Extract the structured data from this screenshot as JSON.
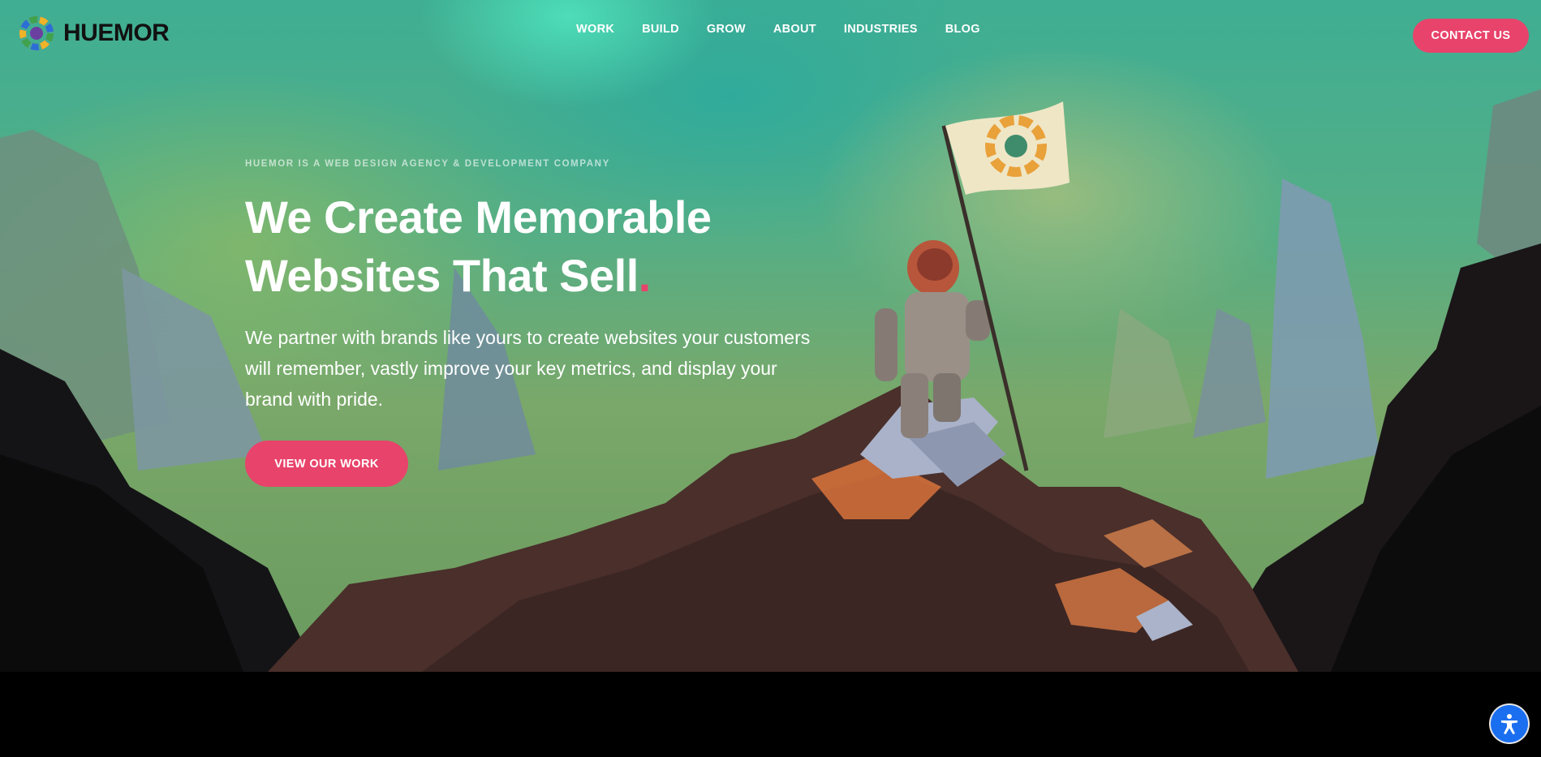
{
  "brand": {
    "name": "HUEMOR"
  },
  "nav": {
    "items": [
      {
        "label": "WORK"
      },
      {
        "label": "BUILD"
      },
      {
        "label": "GROW"
      },
      {
        "label": "ABOUT"
      },
      {
        "label": "INDUSTRIES"
      },
      {
        "label": "BLOG"
      }
    ],
    "contact_label": "CONTACT US"
  },
  "hero": {
    "tagline": "HUEMOR IS A WEB DESIGN AGENCY & DEVELOPMENT COMPANY",
    "headline_line1": "We Create Memorable",
    "headline_line2": "Websites That Sell",
    "headline_dot": ".",
    "subtext": "We partner with brands like yours to create websites your customers will remember, vastly improve your key metrics, and display your brand with pride.",
    "cta_label": "VIEW OUR WORK"
  },
  "icons": {
    "logo": "huemor-color-wheel-logo",
    "accessibility": "accessibility-icon"
  },
  "colors": {
    "accent": "#e8436b",
    "accessibility_button": "#1a6ff0",
    "footer_band": "#000000"
  }
}
